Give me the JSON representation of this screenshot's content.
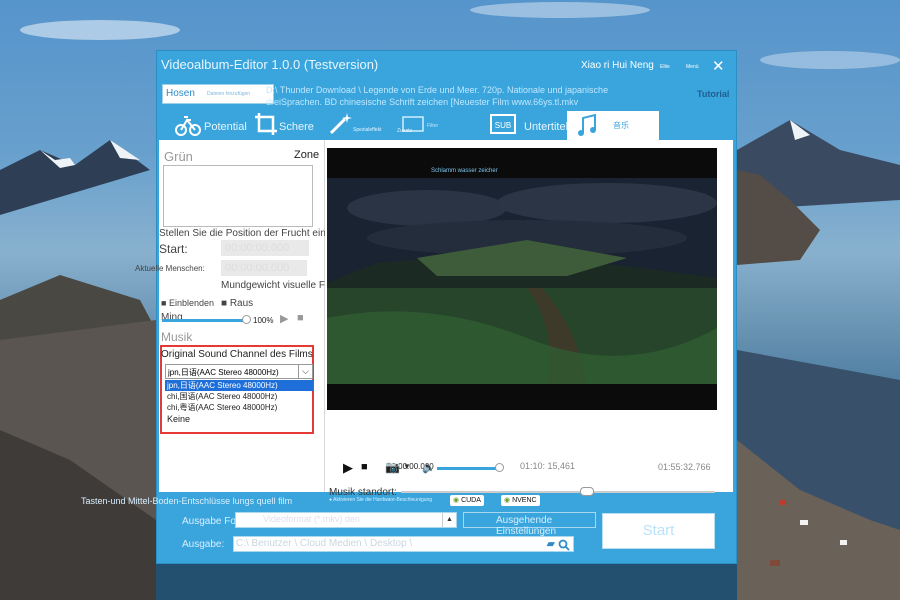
{
  "window": {
    "title": "Videoalbum-Editor 1.0.0 (Testversion)",
    "user": "Xiao ri Hui Neng",
    "link_1": "Elite",
    "link_2": "Menü",
    "close_glyph": "✕"
  },
  "header": {
    "hosen_label": "Hosen",
    "hosen_add": "Dateien hinzufügen",
    "file_path": "D:\\ Thunder Download \\ Legende von Erde und Meer. 720p. Nationale und japanische dreiSprachen. BD chinesische Schrift zeichen [Neuester Film www.66ys.tl.mkv",
    "tutorial": "Tutorial"
  },
  "tabs": [
    {
      "label": "Potential",
      "icon": "bicycle-icon"
    },
    {
      "label": "Schere",
      "icon": "crop-icon"
    },
    {
      "label": "Spezialeffekt",
      "icon": "magic-wand-icon"
    },
    {
      "label": "Zusatz",
      "icon": "watermark-icon"
    },
    {
      "label": "Filter",
      "icon": "filter-icon"
    },
    {
      "label": "Untertitel",
      "icon": "subtitle-icon"
    },
    {
      "label": "音乐",
      "icon": "music-icon"
    }
  ],
  "left_panel": {
    "heading": "Grün",
    "zone": "Zone",
    "position_prompt": "Stellen Sie die Position der Frucht ein:",
    "start_label": "Start:",
    "start_value": "00:00:00.000",
    "current_label": "Aktuelle Menschen:",
    "current_value": "00:00:00.000",
    "weight_label": "Mundgewicht visuelle Frucht",
    "fade_in": "Einblenden",
    "fade_out": "Raus",
    "volume_label": "Ming",
    "volume_percent": "100%",
    "volume_level": 1.0,
    "music_label": "Musik",
    "channel_label": "Original Sound Channel des Films",
    "selected_channel": "jpn,日语(AAC Stereo 48000Hz)",
    "channel_options": [
      "jpn,日语(AAC Stereo 48000Hz)",
      "chi,国语(AAC Stereo 48000Hz)",
      "chi,粤语(AAC Stereo 48000Hz)",
      "Keine"
    ]
  },
  "preview": {
    "watermark_text": "Schlamm wasser zeicher",
    "time_start": "00:00:00.000",
    "time_mid": "01:10: 15,461",
    "time_end": "01:55:32.766",
    "music_position_label": "Musik standort:",
    "music_position": 0.68,
    "player_volume": 0.8
  },
  "bottom": {
    "hardware_label": "Tasten-und Mittel-Boden-Entschlüsse lungs quell film",
    "hw_accel": "Aktivieren Sie die Hardware-Beschleunigung",
    "cuda": "CUDA",
    "nvenc": "NVENC",
    "output_format_label": "Ausgabe Format:",
    "output_format_value": "Videoformat (*.mkv) den",
    "output_settings": "Ausgehende Einstellungen",
    "output_path_label": "Ausgabe:",
    "output_path_value": "C:\\ Benutzer \\ Cloud Medien \\ Desktop \\",
    "start": "Start"
  },
  "colors": {
    "accent": "#3aa5dc",
    "selection": "#1e6fd9",
    "highlight_border": "#e53935"
  }
}
